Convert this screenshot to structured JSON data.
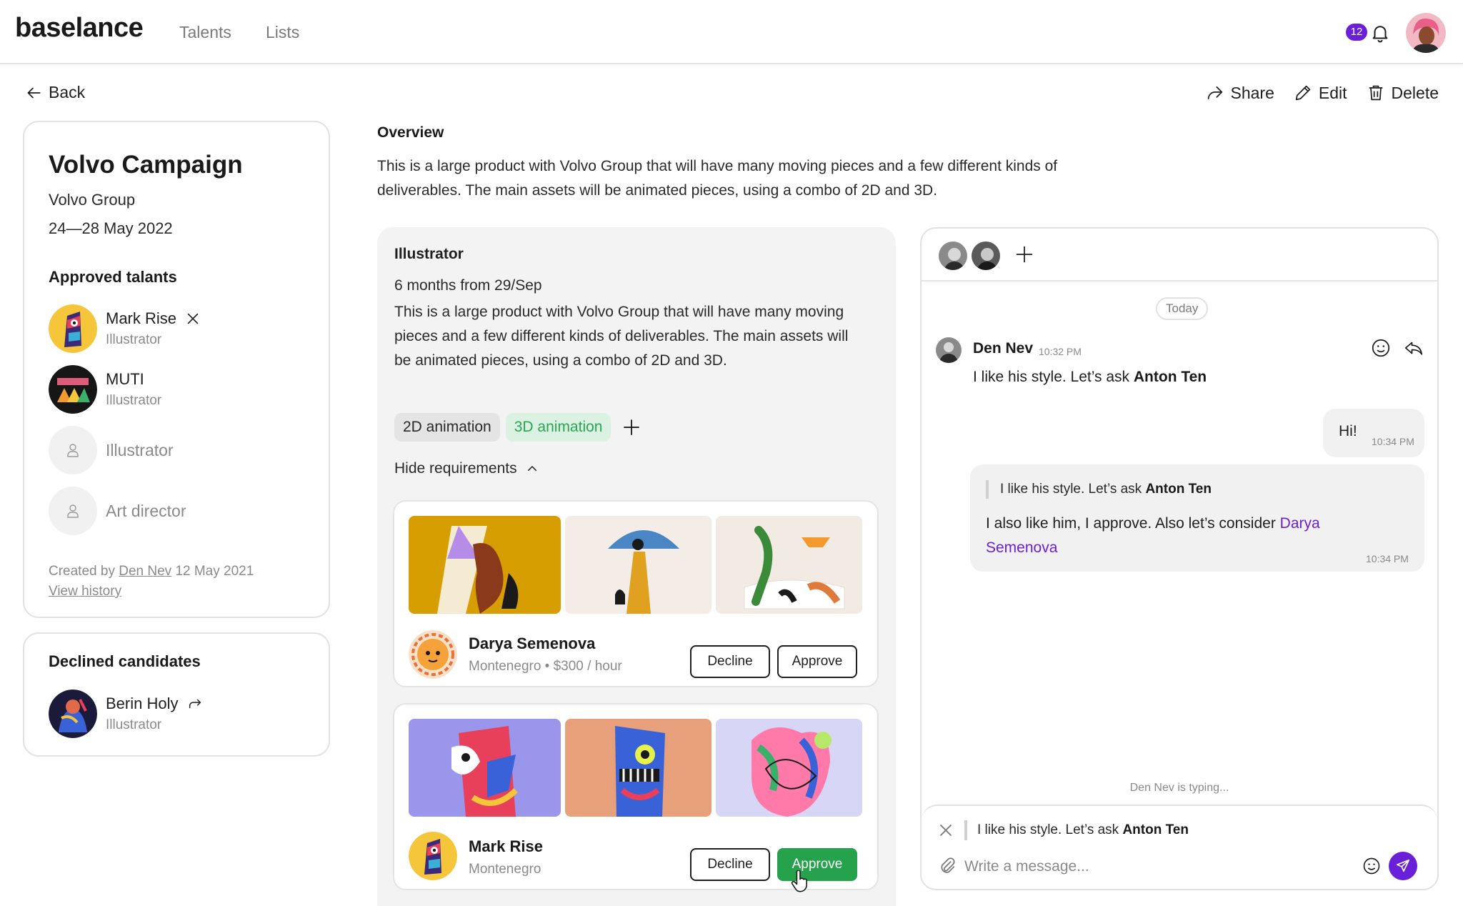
{
  "header": {
    "logo": "baselance",
    "nav": [
      "Talents",
      "Lists"
    ],
    "notification_count": "12",
    "icons": {
      "notifications": "bell-icon",
      "profile": "user-avatar"
    }
  },
  "toolbar": {
    "back_label": "Back",
    "share_label": "Share",
    "edit_label": "Edit",
    "delete_label": "Delete"
  },
  "campaign": {
    "title": "Volvo Campaign",
    "client": "Volvo Group",
    "dates": "24—28 May 2022",
    "approved_heading": "Approved talants",
    "approved": [
      {
        "name": "Mark Rise",
        "role": "Illustrator"
      },
      {
        "name": "MUTI",
        "role": "Illustrator"
      }
    ],
    "open_slots": [
      "Illustrator",
      "Art director"
    ],
    "created_prefix": "Created by",
    "created_by": "Den Nev",
    "created_date": "12 May 2021",
    "view_history": "View history"
  },
  "declined": {
    "heading": "Declined candidates",
    "items": [
      {
        "name": "Berin Holy",
        "role": "Illustrator"
      }
    ]
  },
  "overview": {
    "title": "Overview",
    "text": "This is a large product with Volvo Group that will have many moving pieces and a few different kinds of deliverables. The main assets will be animated pieces, using a combo of 2D and 3D."
  },
  "role_panel": {
    "title": "Illustrator",
    "period": "6 months from 29/Sep",
    "description": "This is a large product with Volvo Group that will have many moving pieces and a few different kinds of deliverables. The main assets will be animated pieces, using a combo of 2D and 3D.",
    "tags": [
      "2D animation",
      "3D animation"
    ],
    "hide_requirements": "Hide requirements",
    "candidates": [
      {
        "name": "Darya Semenova",
        "meta": "Montenegro • $300 / hour",
        "decline": "Decline",
        "approve": "Approve"
      },
      {
        "name": "Mark Rise",
        "meta": "Montenegro",
        "decline": "Decline",
        "approve": "Approve"
      }
    ]
  },
  "chat": {
    "date_divider": "Today",
    "messages": [
      {
        "author": "Den Nev",
        "time": "10:32 PM",
        "text_prefix": "I like his style. Let’s ask ",
        "mention": "Anton Ten"
      },
      {
        "text": "Hi!",
        "time": "10:34 PM"
      },
      {
        "quote_prefix": "I like his style. Let’s ask ",
        "quote_mention": "Anton Ten",
        "text_prefix": "I also like him, I approve. Also let’s consider ",
        "mention": "Darya Semenova",
        "time": "10:34 PM"
      }
    ],
    "typing": "Den Nev is typing...",
    "reply_prefix": "I like his style. Let’s ask ",
    "reply_mention": "Anton Ten",
    "placeholder": "Write a message..."
  },
  "colors": {
    "accent": "#6a1fd8",
    "approve": "#25a24b",
    "tag_green_bg": "#dbf1e1",
    "tag_green_text": "#2ba555"
  }
}
